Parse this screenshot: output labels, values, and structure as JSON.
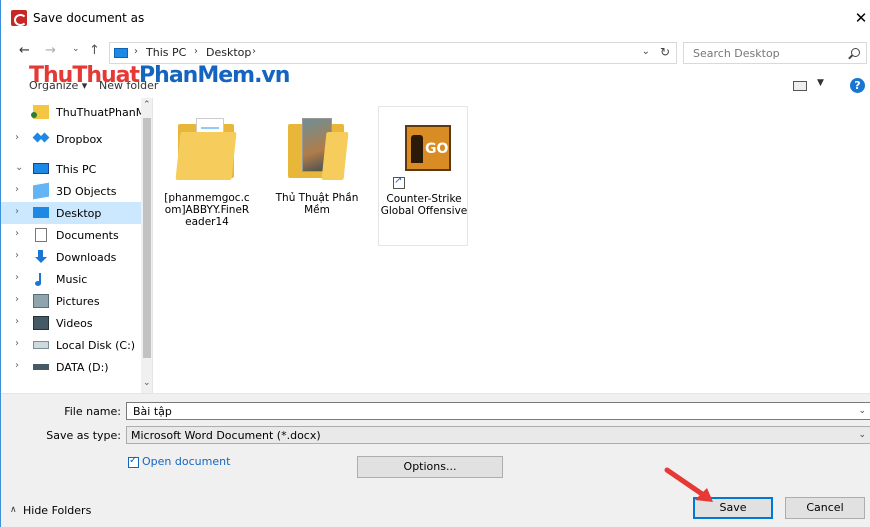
{
  "window": {
    "title": "Save document as",
    "close_glyph": "✕"
  },
  "address": {
    "segments": [
      "This PC",
      "Desktop"
    ],
    "search_placeholder": "Search Desktop"
  },
  "toolbar": {
    "organize_label": "Organize ▾",
    "new_folder_label": "New folder",
    "help_glyph": "?"
  },
  "watermark": {
    "part1": "ThuThuat",
    "part2": "PhanMem.vn"
  },
  "nav_pane": {
    "items": [
      {
        "label": "ThuThuatPhanM",
        "icon": "folder-icon"
      },
      {
        "label": "Dropbox",
        "icon": "dropbox-icon"
      },
      {
        "label": "This PC",
        "icon": "computer-icon"
      },
      {
        "label": "3D Objects",
        "icon": "3d-objects-icon"
      },
      {
        "label": "Desktop",
        "icon": "desktop-icon",
        "selected": true
      },
      {
        "label": "Documents",
        "icon": "documents-icon"
      },
      {
        "label": "Downloads",
        "icon": "downloads-icon"
      },
      {
        "label": "Music",
        "icon": "music-icon"
      },
      {
        "label": "Pictures",
        "icon": "pictures-icon"
      },
      {
        "label": "Videos",
        "icon": "videos-icon"
      },
      {
        "label": "Local Disk (C:)",
        "icon": "local-disk-icon"
      },
      {
        "label": "DATA (D:)",
        "icon": "drive-icon"
      }
    ]
  },
  "files": [
    {
      "label": "[phanmemgoc.com]ABBYY.FineReader14",
      "icon": "folder-icon"
    },
    {
      "label": "Thủ Thuật Phần Mềm",
      "icon": "folder-icon"
    },
    {
      "label": "Counter-Strike Global Offensive",
      "icon": "game-shortcut-icon"
    }
  ],
  "form": {
    "file_name_label": "File name:",
    "file_name_value": "Bài tập",
    "save_type_label": "Save as type:",
    "save_type_value": "Microsoft Word Document (*.docx)",
    "open_document_label": "Open document",
    "open_document_checked": true,
    "options_label": "Options...",
    "hide_folders_label": "Hide Folders",
    "save_label": "Save",
    "cancel_label": "Cancel"
  },
  "colors": {
    "accent": "#0078d7",
    "selection": "#cce8ff",
    "annotation_arrow": "#e53935"
  }
}
